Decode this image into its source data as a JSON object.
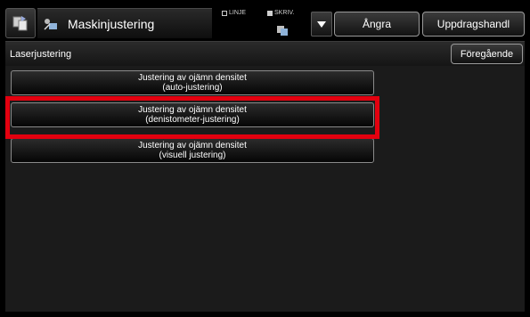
{
  "header": {
    "title": "Maskinjustering",
    "home_icon": "copy-home-icon",
    "title_icon": "machine-adjust-icon",
    "mode_linje": "LINJE",
    "mode_skriv": "SKRIV.",
    "mode_skriv_checked": true,
    "buttons": {
      "undo_label": "Ångra",
      "job_label": "Uppdragshandl"
    }
  },
  "subheader": {
    "title": "Laserjustering",
    "previous_label": "Föregående"
  },
  "options": [
    {
      "line1": "Justering av ojämn densitet",
      "line2": "(auto-justering)"
    },
    {
      "line1": "Justering av ojämn densitet",
      "line2": "(denistometer-justering)",
      "highlighted": true
    },
    {
      "line1": "Justering av ojämn densitet",
      "line2": "(visuell justering)"
    }
  ],
  "colors": {
    "highlight": "#e3000f",
    "background": "#000000",
    "panel": "#1b1b1b"
  }
}
